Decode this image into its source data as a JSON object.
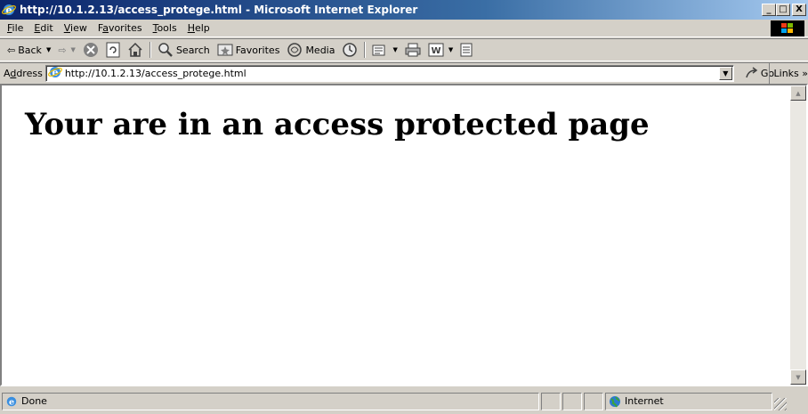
{
  "window": {
    "title": "http://10.1.2.13/access_protege.html - Microsoft Internet Explorer",
    "minimize_glyph": "_",
    "maximize_glyph": "□",
    "close_glyph": "X"
  },
  "menu": [
    {
      "accel": "F",
      "rest": "ile"
    },
    {
      "accel": "E",
      "rest": "dit"
    },
    {
      "accel": "V",
      "rest": "iew"
    },
    {
      "pre": "F",
      "accel": "a",
      "rest": "vorites"
    },
    {
      "accel": "T",
      "rest": "ools"
    },
    {
      "accel": "H",
      "rest": "elp"
    }
  ],
  "toolbar": {
    "back_label": "Back",
    "search_label": "Search",
    "favorites_label": "Favorites",
    "media_label": "Media"
  },
  "address": {
    "label_pre": "A",
    "label_accel": "d",
    "label_rest": "dress",
    "url": "http://10.1.2.13/access_protege.html",
    "go_label": "Go",
    "links_label": "Links »"
  },
  "page": {
    "heading": "Your are in an access protected page"
  },
  "status": {
    "text": "Done",
    "zone": "Internet"
  },
  "colors": {
    "titlebar_start": "#0a246a",
    "titlebar_end": "#a6caf0",
    "chrome": "#d4d0c8"
  },
  "icons": [
    "ie-logo-icon",
    "back-arrow-icon",
    "forward-arrow-icon",
    "stop-icon",
    "refresh-icon",
    "home-icon",
    "search-icon",
    "favorites-icon",
    "media-icon",
    "history-icon",
    "mail-icon",
    "print-icon",
    "edit-icon",
    "discuss-icon",
    "go-icon",
    "globe-icon",
    "windows-logo-icon"
  ]
}
